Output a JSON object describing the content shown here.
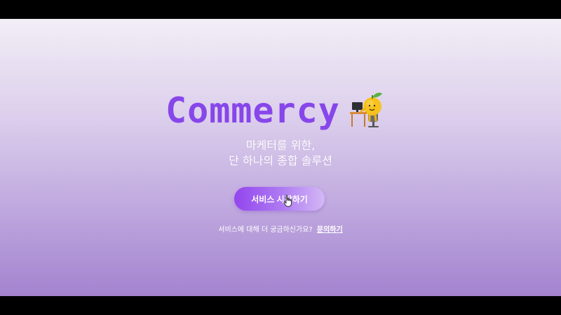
{
  "brand": {
    "name": "Commercy",
    "color": "#8746ea"
  },
  "hero": {
    "subtitle_line1": "마케터를 위한,",
    "subtitle_line2": "단 하나의 종합 솔루션"
  },
  "cta": {
    "label": "서비스 시작하기"
  },
  "inquiry": {
    "text": "서비스에 대해 더 궁금하신가요?",
    "link_label": "문의하기"
  },
  "icons": {
    "mascot": "orange-at-desk-icon",
    "cursor": "hand-pointer-icon"
  }
}
